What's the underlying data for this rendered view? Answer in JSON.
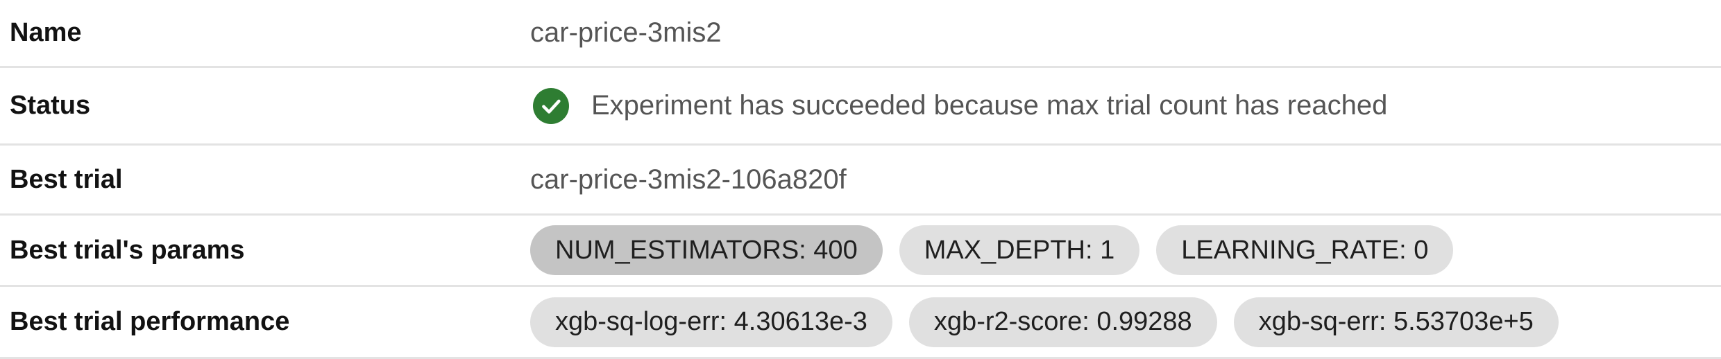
{
  "rows": {
    "name": {
      "label": "Name",
      "value": "car-price-3mis2"
    },
    "status": {
      "label": "Status",
      "icon": "check-circle-icon",
      "icon_color": "#2e7d32",
      "value": "Experiment has succeeded because max trial count has reached"
    },
    "best_trial": {
      "label": "Best trial",
      "value": "car-price-3mis2-106a820f"
    },
    "best_params": {
      "label": "Best trial's params",
      "chips": [
        "NUM_ESTIMATORS: 400",
        "MAX_DEPTH: 1",
        "LEARNING_RATE: 0"
      ]
    },
    "best_performance": {
      "label": "Best trial performance",
      "chips": [
        "xgb-sq-log-err: 4.30613e-3",
        "xgb-r2-score: 0.99288",
        "xgb-sq-err: 5.53703e+5"
      ]
    }
  }
}
